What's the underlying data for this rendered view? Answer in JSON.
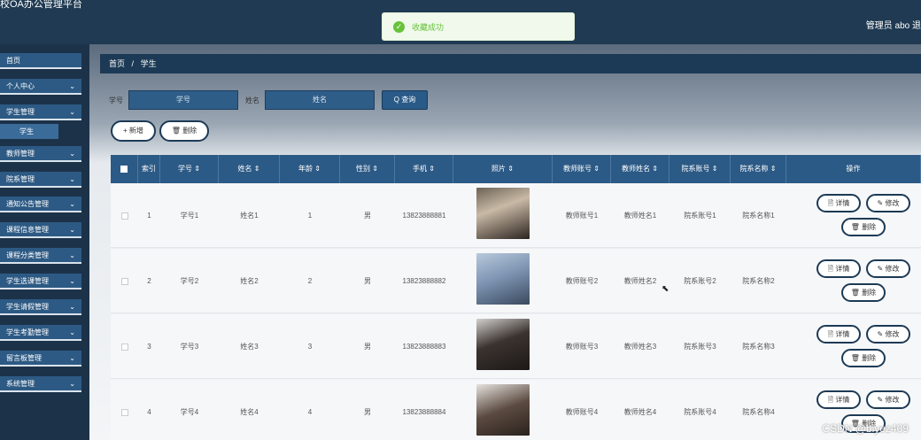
{
  "app": {
    "title": "校OA办公管理平台",
    "user_text": "管理员 abo 退"
  },
  "toast": {
    "message": "收藏成功"
  },
  "sidebar": {
    "items": [
      {
        "label": "首页",
        "chevron": false
      },
      {
        "label": "个人中心",
        "chevron": true
      },
      {
        "label": "学生管理",
        "chevron": true
      },
      {
        "label": "教师管理",
        "chevron": true
      },
      {
        "label": "院系管理",
        "chevron": true
      },
      {
        "label": "通知公告管理",
        "chevron": true
      },
      {
        "label": "课程信息管理",
        "chevron": true
      },
      {
        "label": "课程分类管理",
        "chevron": true
      },
      {
        "label": "学生选课管理",
        "chevron": true
      },
      {
        "label": "学生请假管理",
        "chevron": true
      },
      {
        "label": "学生考勤管理",
        "chevron": true
      },
      {
        "label": "留言板管理",
        "chevron": true
      },
      {
        "label": "系统管理",
        "chevron": true
      }
    ],
    "sub_item": "学生"
  },
  "breadcrumb": {
    "home": "首页",
    "sep": "/",
    "current": "学生"
  },
  "search": {
    "label1": "学号",
    "placeholder1": "学号",
    "label2": "姓名",
    "placeholder2": "姓名",
    "query_button": "Q 查询"
  },
  "actions": {
    "add": "+ 新增",
    "delete": "🗑 删除"
  },
  "table": {
    "headers": [
      "",
      "索引",
      "学号 ⇕",
      "姓名 ⇕",
      "年龄 ⇕",
      "性别 ⇕",
      "手机 ⇕",
      "照片 ⇕",
      "教师账号 ⇕",
      "教师姓名 ⇕",
      "院系账号 ⇕",
      "院系名称 ⇕",
      "操作"
    ],
    "rows": [
      {
        "index": "1",
        "xuehao": "学号1",
        "name": "姓名1",
        "age": "1",
        "gender": "男",
        "phone": "13823888881",
        "teacher_acc": "教师账号1",
        "teacher_name": "教师姓名1",
        "dept_acc": "院系账号1",
        "dept_name": "院系名称1"
      },
      {
        "index": "2",
        "xuehao": "学号2",
        "name": "姓名2",
        "age": "2",
        "gender": "男",
        "phone": "13823888882",
        "teacher_acc": "教师账号2",
        "teacher_name": "教师姓名2",
        "dept_acc": "院系账号2",
        "dept_name": "院系名称2"
      },
      {
        "index": "3",
        "xuehao": "学号3",
        "name": "姓名3",
        "age": "3",
        "gender": "男",
        "phone": "13823888883",
        "teacher_acc": "教师账号3",
        "teacher_name": "教师姓名3",
        "dept_acc": "院系账号3",
        "dept_name": "院系名称3"
      },
      {
        "index": "4",
        "xuehao": "学号4",
        "name": "姓名4",
        "age": "4",
        "gender": "男",
        "phone": "13823888884",
        "teacher_acc": "教师账号4",
        "teacher_name": "教师姓名4",
        "dept_acc": "院系账号4",
        "dept_name": "院系名称4"
      }
    ],
    "row_buttons": {
      "detail": "🗎 详情",
      "edit": "✎ 修改",
      "delete": "🗑 删除"
    }
  },
  "watermark": "CSDN @biyez409",
  "colors": {
    "primary": "#2c5a86",
    "dark": "#1c3a55",
    "success": "#67c23a"
  }
}
